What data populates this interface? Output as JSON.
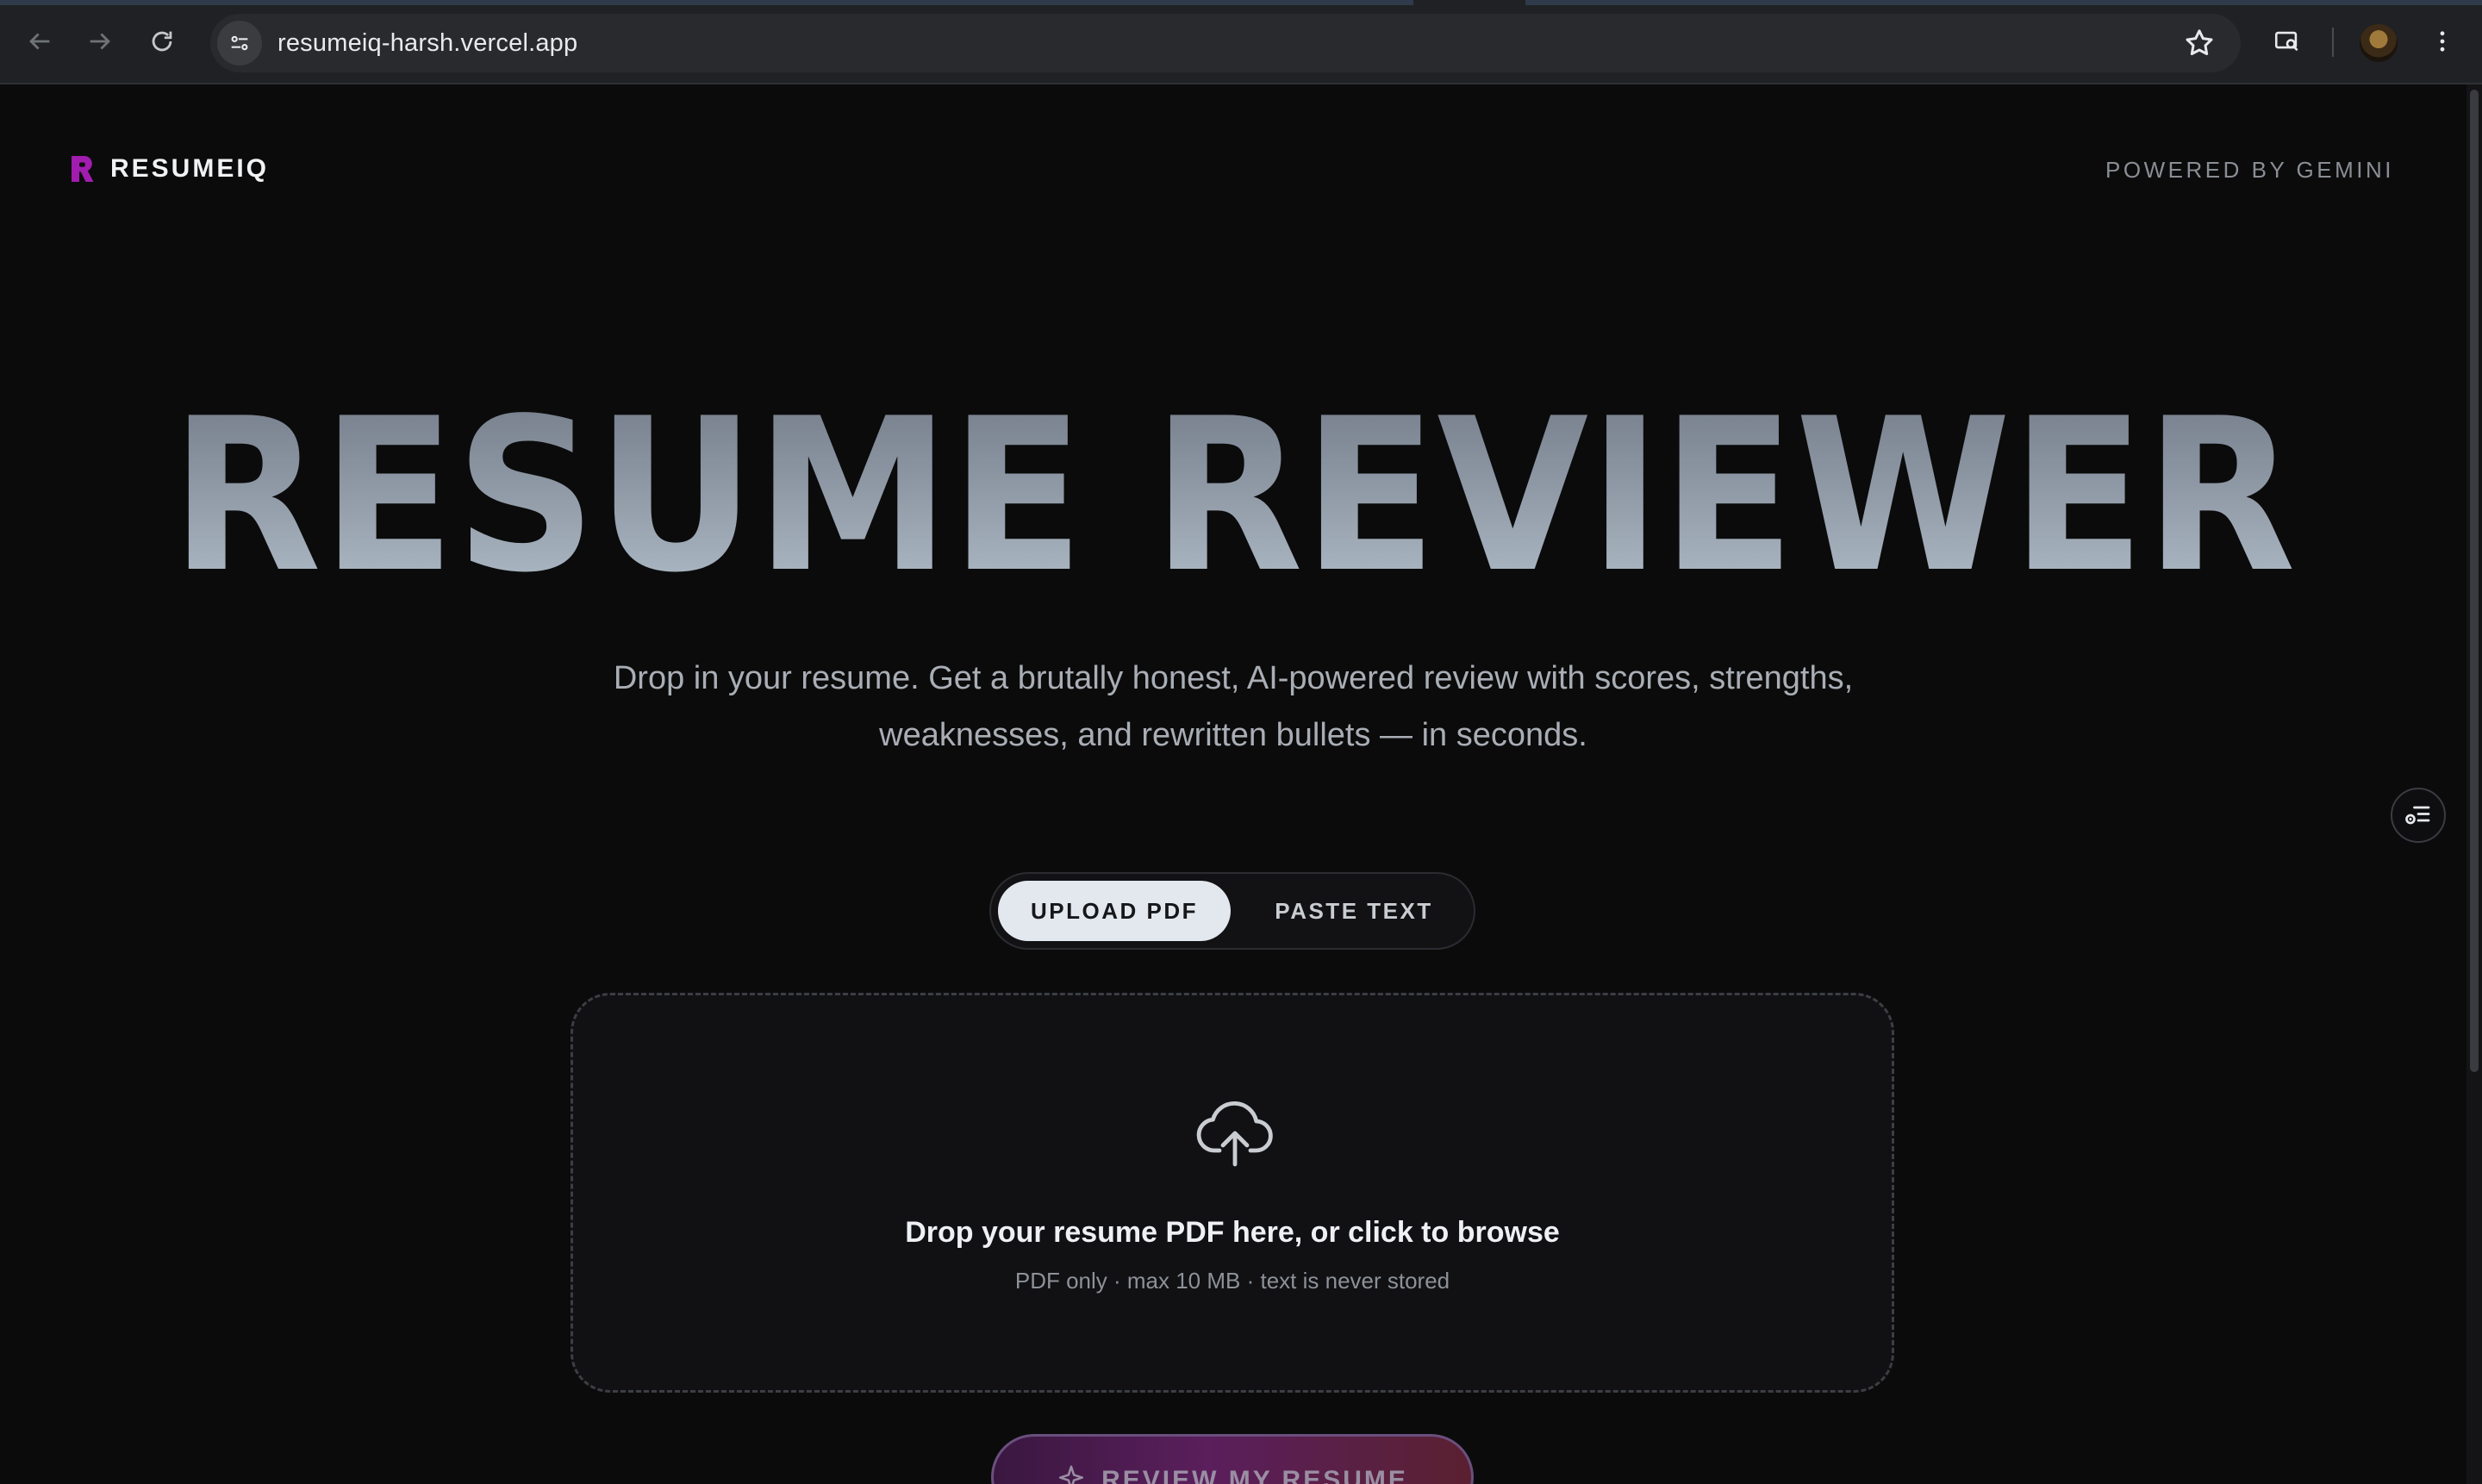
{
  "browser": {
    "url": "resumeiq-harsh.vercel.app",
    "icons": [
      "back-icon",
      "forward-icon",
      "reload-icon",
      "site-info-icon",
      "bookmark-star-icon",
      "cast-search-icon",
      "avatar",
      "more-menu-icon"
    ]
  },
  "header": {
    "brand_name": "RESUMEIQ",
    "brand_color": "#a21caf",
    "powered_by": "POWERED BY GEMINI"
  },
  "hero": {
    "title": "RESUME REVIEWER",
    "subtitle": "Drop in your resume. Get a brutally honest, AI-powered review with scores, strengths, weaknesses, and rewritten bullets — in seconds."
  },
  "mode_toggle": {
    "options": [
      {
        "label": "UPLOAD PDF",
        "active": true
      },
      {
        "label": "PASTE TEXT",
        "active": false
      }
    ]
  },
  "dropzone": {
    "title": "Drop your resume PDF here, or click to browse",
    "subtitle": "PDF only · max 10 MB · text is never stored",
    "icon": "cloud-upload-icon"
  },
  "cta": {
    "label": "REVIEW MY RESUME",
    "icon": "sparkle-icon"
  },
  "floating": {
    "icon": "settings-list-icon"
  }
}
